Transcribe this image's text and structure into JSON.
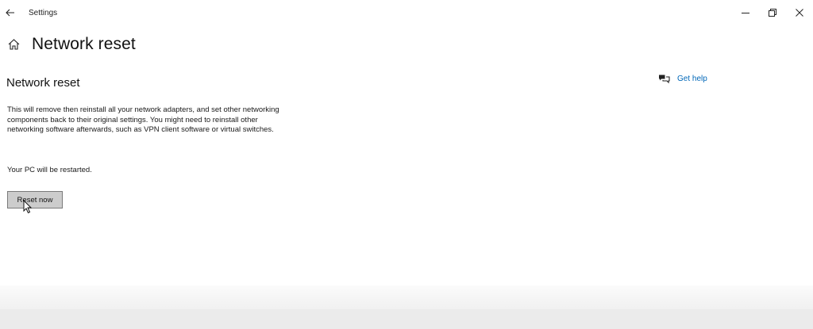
{
  "window": {
    "title": "Settings"
  },
  "header": {
    "page_title": "Network reset"
  },
  "section": {
    "title": "Network reset",
    "description": "This will remove then reinstall all your network adapters, and set other networking components back to their original settings. You might need to reinstall other networking software afterwards, such as VPN client software or virtual switches.",
    "restart_note": "Your PC will be restarted.",
    "reset_button_label": "Reset now"
  },
  "help": {
    "link_label": "Get help"
  },
  "icons": {
    "back": "back-arrow-icon",
    "home": "home-icon",
    "help": "chat-help-icon",
    "minimize": "minimize-icon",
    "restore": "restore-icon",
    "close": "close-icon",
    "cursor": "mouse-pointer-icon"
  },
  "colors": {
    "link": "#0067b8",
    "button_bg": "#cccccc",
    "button_border": "#7a7a7a"
  }
}
